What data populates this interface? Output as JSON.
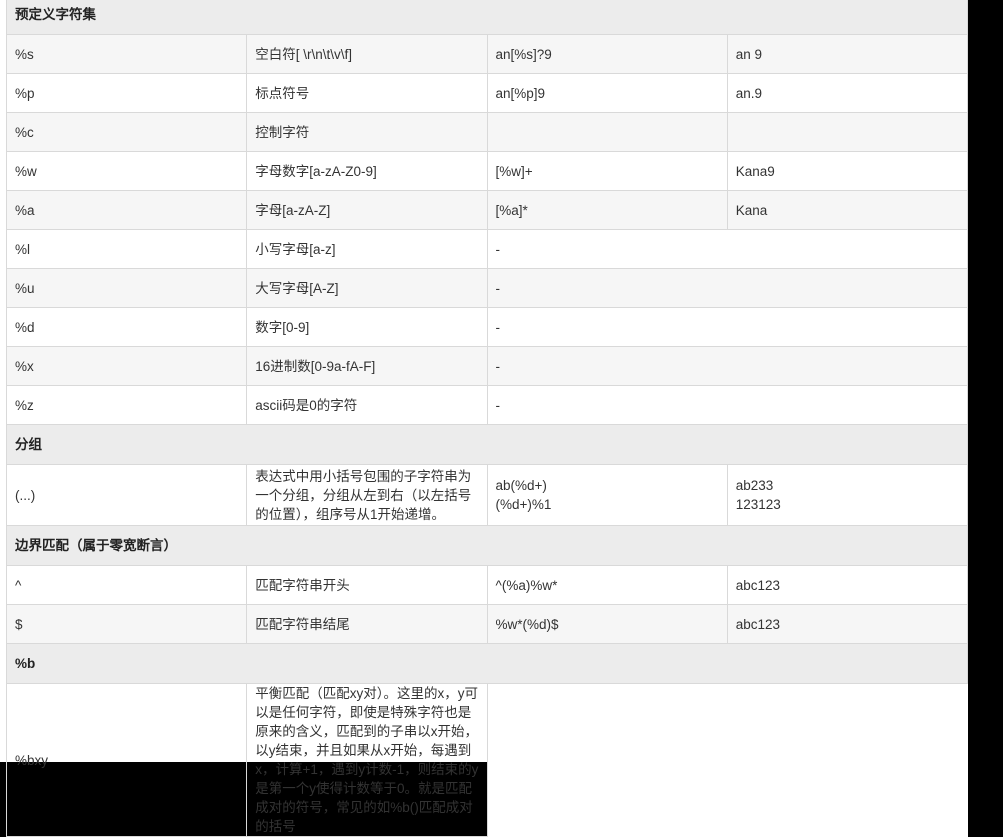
{
  "sections": {
    "predefined": "预定义字符集",
    "group": "分组",
    "boundary": "边界匹配（属于零宽断言）",
    "balanced": "%b"
  },
  "rows": {
    "s": {
      "pattern": "%s",
      "desc": "空白符[ \\r\\n\\t\\v\\f]",
      "example": "an[%s]?9",
      "result": "an 9"
    },
    "p": {
      "pattern": "%p",
      "desc": "标点符号",
      "example": "an[%p]9",
      "result": "an.9"
    },
    "c": {
      "pattern": "%c",
      "desc": "控制字符",
      "example": "",
      "result": ""
    },
    "w": {
      "pattern": "%w",
      "desc": "字母数字[a-zA-Z0-9]",
      "example": "[%w]+",
      "result": "Kana9"
    },
    "a": {
      "pattern": "%a",
      "desc": "字母[a-zA-Z]",
      "example": "[%a]*",
      "result": "Kana"
    },
    "l": {
      "pattern": "%l",
      "desc": "小写字母[a-z]",
      "example": "-"
    },
    "u": {
      "pattern": "%u",
      "desc": "大写字母[A-Z]",
      "example": "-"
    },
    "d": {
      "pattern": "%d",
      "desc": "数字[0-9]",
      "example": "-"
    },
    "x": {
      "pattern": "%x",
      "desc": "16进制数[0-9a-fA-F]",
      "example": "-"
    },
    "z": {
      "pattern": "%z",
      "desc": "ascii码是0的字符",
      "example": "-"
    },
    "grp": {
      "pattern": "(...)",
      "desc": "表达式中用小括号包围的子字符串为一个分组，分组从左到右（以左括号的位置），组序号从1开始递增。",
      "example_line1": "ab(%d+)",
      "example_line2": "(%d+)%1",
      "result_line1": "ab233",
      "result_line2": "123123"
    },
    "caret": {
      "pattern": "^",
      "desc": "匹配字符串开头",
      "example": "^(%a)%w*",
      "result": "abc123"
    },
    "dollar": {
      "pattern": "$",
      "desc": "匹配字符串结尾",
      "example": "%w*(%d)$",
      "result": "abc123"
    },
    "bxy": {
      "pattern": "%bxy",
      "desc": "平衡匹配（匹配xy对）。这里的x，y可以是任何字符，即使是特殊字符也是原来的含义，匹配到的子串以x开始，以y结束，并且如果从x开始，每遇到x，计算+1，遇到y计数-1，则结束的y是第一个y使得计数等于0。就是匹配成对的符号，常见的如%b()匹配成对的括号"
    }
  }
}
